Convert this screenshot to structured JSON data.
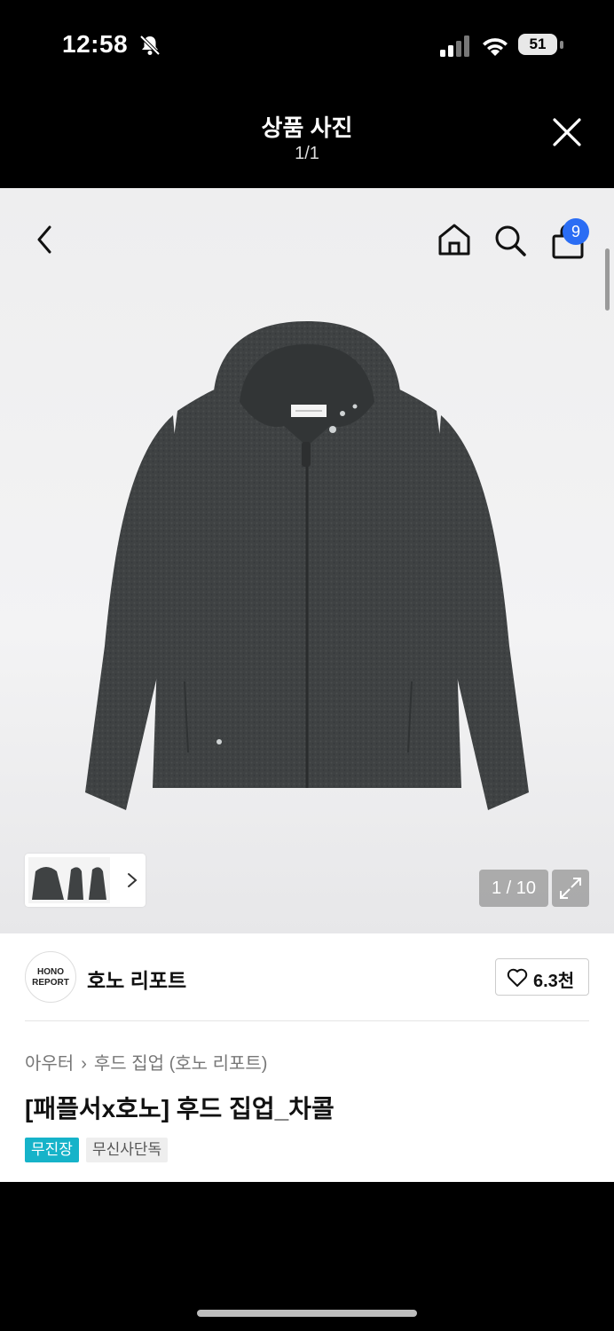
{
  "status_bar": {
    "time": "12:58",
    "battery_level": "51",
    "icons": [
      "bell-slash-icon",
      "signal-bars-icon",
      "wifi-icon",
      "battery-icon"
    ]
  },
  "modal": {
    "title": "상품 사진",
    "counter": "1/1",
    "close_icon": "close-icon"
  },
  "product_nav": {
    "icons": [
      "back-arrow-icon",
      "home-icon",
      "search-icon",
      "shopping-bag-icon"
    ],
    "cart_count": "9"
  },
  "gallery": {
    "counter": "1 / 10",
    "thumb_chevron_icon": "chevron-right-icon",
    "expand_icon": "expand-icon"
  },
  "brand": {
    "logo_line1": "HONO",
    "logo_line2": "REPORT",
    "name": "호노 리포트",
    "likes": "6.3천"
  },
  "breadcrumb": {
    "category": "아우터",
    "subcategory": "후드 집업 (호노 리포트)"
  },
  "product": {
    "title": "[패플서x호노] 후드 집업_차콜",
    "tags": [
      "무진장",
      "무신사단독"
    ]
  },
  "colors": {
    "badge_blue": "#2a6df4",
    "tag_teal": "#16b3c9",
    "garment_charcoal": "#3d4041"
  }
}
